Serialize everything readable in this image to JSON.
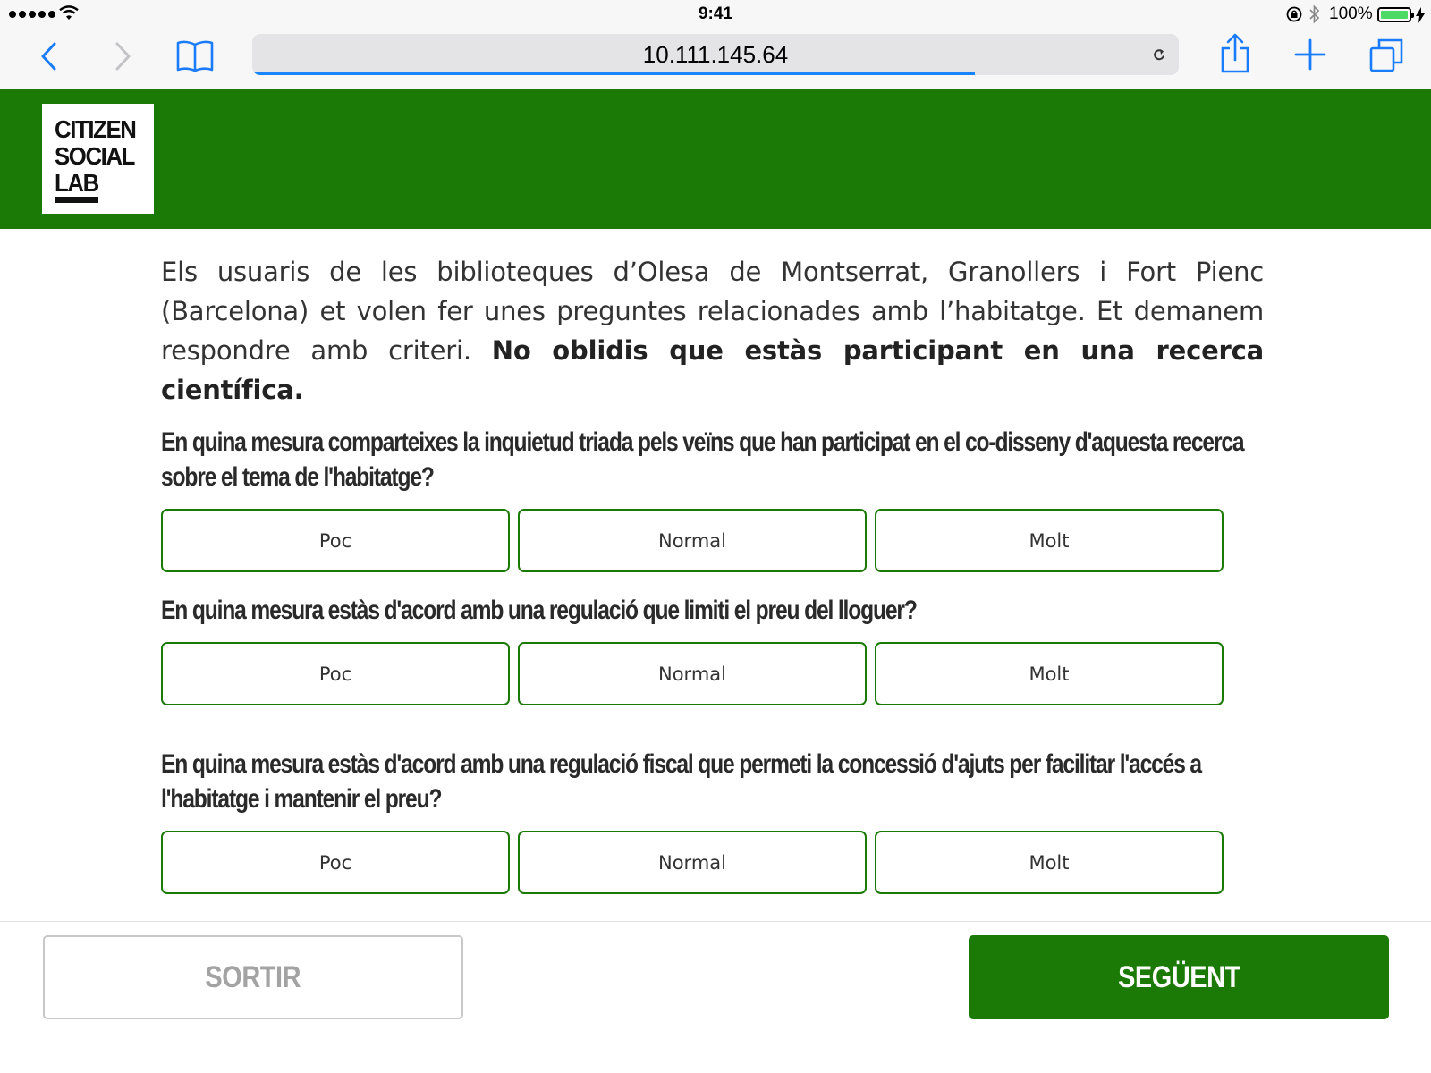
{
  "status_bar": {
    "time": "9:41",
    "battery_percent": "100%",
    "icons": [
      "signal-dots-icon",
      "wifi-icon",
      "rotation-lock-icon",
      "bluetooth-icon",
      "battery-icon",
      "charging-bolt-icon"
    ]
  },
  "browser": {
    "url": "10.111.145.64",
    "load_progress": 0.78,
    "icons": [
      "back-chevron-icon",
      "forward-chevron-icon",
      "bookmarks-book-icon",
      "reload-icon",
      "share-icon",
      "new-tab-plus-icon",
      "tabs-icon"
    ]
  },
  "header": {
    "logo_lines": [
      "CITIZEN",
      "SOCIAL",
      "LAB"
    ],
    "brand_color": "#1b7a06"
  },
  "intro": {
    "text": "Els usuaris de les biblioteques d’Olesa de Montserrat, Granollers i Fort Pienc (Barcelona) et volen fer unes preguntes relacionades amb l’habitatge. Et demanem respondre amb criteri. ",
    "emphasis": "No oblidis que estàs participant en una recerca científica."
  },
  "questions": [
    {
      "text": "En quina mesura comparteixes la inquietud triada pels veïns que han participat en el co-disseny d'aquesta recerca sobre el tema de l'habitatge?",
      "options": [
        "Poc",
        "Normal",
        "Molt"
      ]
    },
    {
      "text": "En quina mesura estàs d'acord amb una regulació que limiti el preu del lloguer?",
      "options": [
        "Poc",
        "Normal",
        "Molt"
      ]
    },
    {
      "text": "En quina mesura estàs d'acord amb una regulació fiscal que permeti la concessió d'ajuts per facilitar l'accés a l'habitatge i mantenir el preu?",
      "options": [
        "Poc",
        "Normal",
        "Molt"
      ]
    }
  ],
  "footer": {
    "exit_label": "SORTIR",
    "next_label": "SEGÜENT"
  }
}
